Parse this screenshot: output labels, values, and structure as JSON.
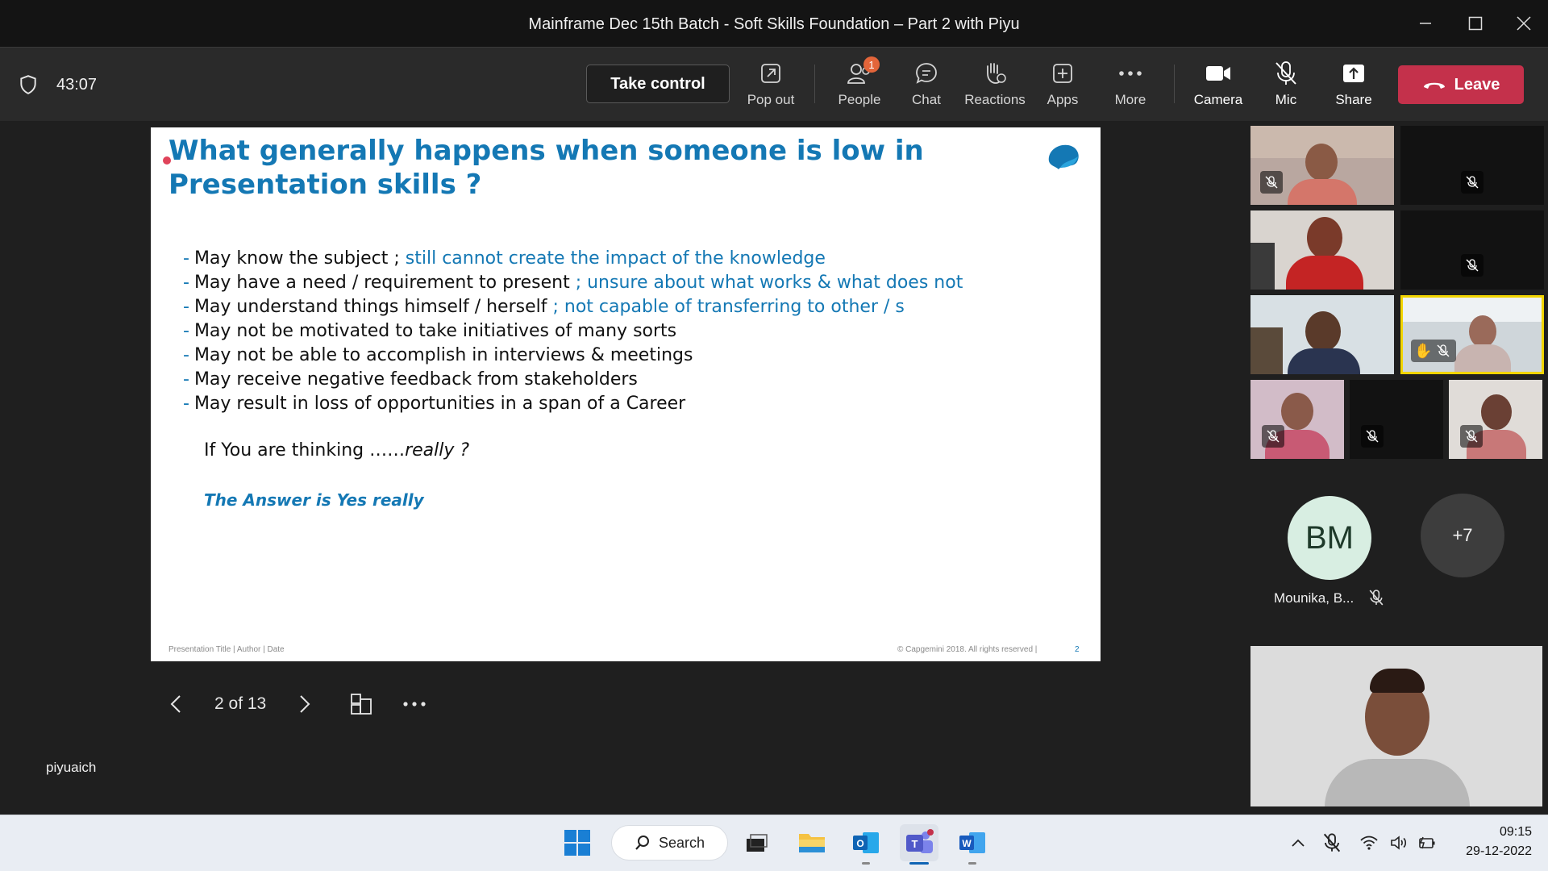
{
  "window": {
    "title": "Mainframe Dec 15th Batch - Soft Skills Foundation – Part 2 with Piyu"
  },
  "toolbar": {
    "timer": "43:07",
    "take_control": "Take control",
    "pop_out": "Pop out",
    "people": "People",
    "people_badge": "1",
    "chat": "Chat",
    "reactions": "Reactions",
    "apps": "Apps",
    "more": "More",
    "camera": "Camera",
    "mic": "Mic",
    "share": "Share",
    "leave": "Leave"
  },
  "slide": {
    "title": "What generally happens when someone is low in Presentation skills ?",
    "bullets": [
      {
        "text": "May know the subject ; ",
        "highlight": "still cannot create the impact of the knowledge"
      },
      {
        "text": "May have a need / requirement to present ",
        "highlight": "; unsure about what works & what does not"
      },
      {
        "text": "May understand things himself / herself ",
        "highlight": "; not capable of transferring to other / s"
      },
      {
        "text": "May not be motivated to take initiatives of many sorts",
        "highlight": ""
      },
      {
        "text": "May not be able to accomplish in interviews & meetings",
        "highlight": ""
      },
      {
        "text": "May receive negative feedback from stakeholders",
        "highlight": ""
      },
      {
        "text": "May result in loss of opportunities in a span of a Career",
        "highlight": ""
      }
    ],
    "thinking": "If You are thinking ……",
    "thinking_italic": "really ?",
    "answer": "The Answer is Yes really",
    "footer_left": "Presentation Title | Author | Date",
    "footer_right": "© Capgemini 2018. All rights reserved  |",
    "footer_page": "2"
  },
  "slide_nav": {
    "page": "2 of 13"
  },
  "presenter": {
    "name": "piyuaich"
  },
  "participants": {
    "bm_initials": "BM",
    "bm_name": "Mounika, B...",
    "more_count": "+7"
  },
  "taskbar": {
    "search": "Search",
    "time": "09:15",
    "date": "29-12-2022"
  },
  "colors": {
    "slide_accent": "#1478b4",
    "leave": "#c4314b",
    "badge": "#e3653a",
    "spotlight": "#f2d500"
  }
}
